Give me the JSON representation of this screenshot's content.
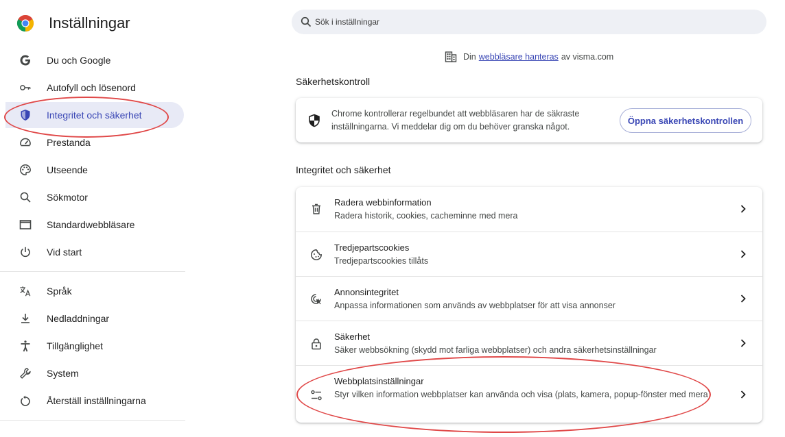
{
  "app": {
    "title": "Inställningar"
  },
  "sidebar": {
    "items": [
      {
        "label": "Du och Google",
        "icon": "google-g-icon"
      },
      {
        "label": "Autofyll och lösenord",
        "icon": "key-icon"
      },
      {
        "label": "Integritet och säkerhet",
        "icon": "shield-icon",
        "active": true
      },
      {
        "label": "Prestanda",
        "icon": "speedometer-icon"
      },
      {
        "label": "Utseende",
        "icon": "palette-icon"
      },
      {
        "label": "Sökmotor",
        "icon": "search-icon"
      },
      {
        "label": "Standardwebbläsare",
        "icon": "browser-window-icon"
      },
      {
        "label": "Vid start",
        "icon": "power-icon"
      }
    ],
    "items2": [
      {
        "label": "Språk",
        "icon": "translate-icon"
      },
      {
        "label": "Nedladdningar",
        "icon": "download-icon"
      },
      {
        "label": "Tillgänglighet",
        "icon": "accessibility-icon"
      },
      {
        "label": "System",
        "icon": "wrench-icon"
      },
      {
        "label": "Återställ inställningarna",
        "icon": "reset-icon"
      }
    ]
  },
  "search": {
    "placeholder": "Sök i inställningar"
  },
  "managed": {
    "prefix": "Din",
    "link": "webbläsare hanteras",
    "suffix": "av visma.com"
  },
  "safety_check": {
    "section_title": "Säkerhetskontroll",
    "text": "Chrome kontrollerar regelbundet att webbläsaren har de säkraste inställningarna. Vi meddelar dig om du behöver granska något.",
    "button": "Öppna säkerhetskontrollen"
  },
  "privacy": {
    "section_title": "Integritet och säkerhet",
    "rows": [
      {
        "title": "Radera webbinformation",
        "subtitle": "Radera historik, cookies, cacheminne med mera",
        "icon": "trash-icon"
      },
      {
        "title": "Tredjepartscookies",
        "subtitle": "Tredjepartscookies tillåts",
        "icon": "cookie-icon"
      },
      {
        "title": "Annonsintegritet",
        "subtitle": "Anpassa informationen som används av webbplatser för att visa annonser",
        "icon": "ad-privacy-icon"
      },
      {
        "title": "Säkerhet",
        "subtitle": "Säker webbsökning (skydd mot farliga webbplatser) och andra säkerhetsinställningar",
        "icon": "lock-icon"
      },
      {
        "title": "Webbplatsinställningar",
        "subtitle": "Styr vilken information webbplatser kan använda och visa (plats, kamera, popup-fönster med mera)",
        "icon": "tune-icon"
      }
    ]
  },
  "colors": {
    "accent": "#3a47b5",
    "active_bg": "#e8eaf6",
    "annotation": "#e04848"
  }
}
